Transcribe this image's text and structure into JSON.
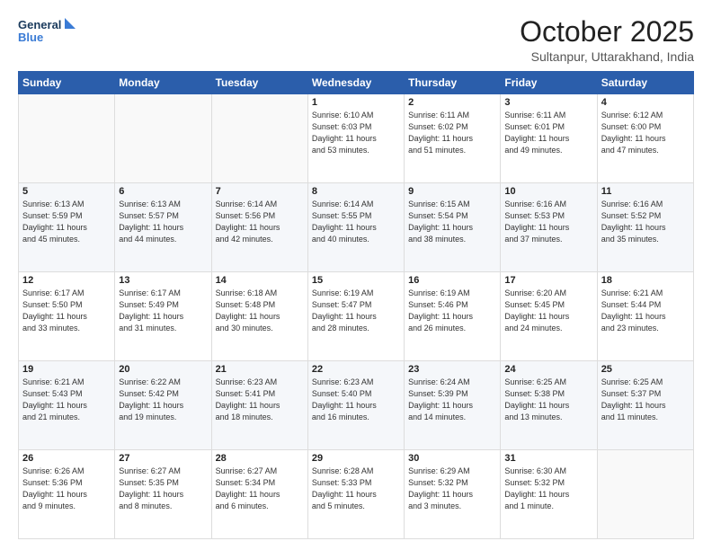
{
  "header": {
    "logo_line1": "General",
    "logo_line2": "Blue",
    "month": "October 2025",
    "location": "Sultanpur, Uttarakhand, India"
  },
  "days_of_week": [
    "Sunday",
    "Monday",
    "Tuesday",
    "Wednesday",
    "Thursday",
    "Friday",
    "Saturday"
  ],
  "weeks": [
    [
      {
        "day": "",
        "info": ""
      },
      {
        "day": "",
        "info": ""
      },
      {
        "day": "",
        "info": ""
      },
      {
        "day": "1",
        "info": "Sunrise: 6:10 AM\nSunset: 6:03 PM\nDaylight: 11 hours\nand 53 minutes."
      },
      {
        "day": "2",
        "info": "Sunrise: 6:11 AM\nSunset: 6:02 PM\nDaylight: 11 hours\nand 51 minutes."
      },
      {
        "day": "3",
        "info": "Sunrise: 6:11 AM\nSunset: 6:01 PM\nDaylight: 11 hours\nand 49 minutes."
      },
      {
        "day": "4",
        "info": "Sunrise: 6:12 AM\nSunset: 6:00 PM\nDaylight: 11 hours\nand 47 minutes."
      }
    ],
    [
      {
        "day": "5",
        "info": "Sunrise: 6:13 AM\nSunset: 5:59 PM\nDaylight: 11 hours\nand 45 minutes."
      },
      {
        "day": "6",
        "info": "Sunrise: 6:13 AM\nSunset: 5:57 PM\nDaylight: 11 hours\nand 44 minutes."
      },
      {
        "day": "7",
        "info": "Sunrise: 6:14 AM\nSunset: 5:56 PM\nDaylight: 11 hours\nand 42 minutes."
      },
      {
        "day": "8",
        "info": "Sunrise: 6:14 AM\nSunset: 5:55 PM\nDaylight: 11 hours\nand 40 minutes."
      },
      {
        "day": "9",
        "info": "Sunrise: 6:15 AM\nSunset: 5:54 PM\nDaylight: 11 hours\nand 38 minutes."
      },
      {
        "day": "10",
        "info": "Sunrise: 6:16 AM\nSunset: 5:53 PM\nDaylight: 11 hours\nand 37 minutes."
      },
      {
        "day": "11",
        "info": "Sunrise: 6:16 AM\nSunset: 5:52 PM\nDaylight: 11 hours\nand 35 minutes."
      }
    ],
    [
      {
        "day": "12",
        "info": "Sunrise: 6:17 AM\nSunset: 5:50 PM\nDaylight: 11 hours\nand 33 minutes."
      },
      {
        "day": "13",
        "info": "Sunrise: 6:17 AM\nSunset: 5:49 PM\nDaylight: 11 hours\nand 31 minutes."
      },
      {
        "day": "14",
        "info": "Sunrise: 6:18 AM\nSunset: 5:48 PM\nDaylight: 11 hours\nand 30 minutes."
      },
      {
        "day": "15",
        "info": "Sunrise: 6:19 AM\nSunset: 5:47 PM\nDaylight: 11 hours\nand 28 minutes."
      },
      {
        "day": "16",
        "info": "Sunrise: 6:19 AM\nSunset: 5:46 PM\nDaylight: 11 hours\nand 26 minutes."
      },
      {
        "day": "17",
        "info": "Sunrise: 6:20 AM\nSunset: 5:45 PM\nDaylight: 11 hours\nand 24 minutes."
      },
      {
        "day": "18",
        "info": "Sunrise: 6:21 AM\nSunset: 5:44 PM\nDaylight: 11 hours\nand 23 minutes."
      }
    ],
    [
      {
        "day": "19",
        "info": "Sunrise: 6:21 AM\nSunset: 5:43 PM\nDaylight: 11 hours\nand 21 minutes."
      },
      {
        "day": "20",
        "info": "Sunrise: 6:22 AM\nSunset: 5:42 PM\nDaylight: 11 hours\nand 19 minutes."
      },
      {
        "day": "21",
        "info": "Sunrise: 6:23 AM\nSunset: 5:41 PM\nDaylight: 11 hours\nand 18 minutes."
      },
      {
        "day": "22",
        "info": "Sunrise: 6:23 AM\nSunset: 5:40 PM\nDaylight: 11 hours\nand 16 minutes."
      },
      {
        "day": "23",
        "info": "Sunrise: 6:24 AM\nSunset: 5:39 PM\nDaylight: 11 hours\nand 14 minutes."
      },
      {
        "day": "24",
        "info": "Sunrise: 6:25 AM\nSunset: 5:38 PM\nDaylight: 11 hours\nand 13 minutes."
      },
      {
        "day": "25",
        "info": "Sunrise: 6:25 AM\nSunset: 5:37 PM\nDaylight: 11 hours\nand 11 minutes."
      }
    ],
    [
      {
        "day": "26",
        "info": "Sunrise: 6:26 AM\nSunset: 5:36 PM\nDaylight: 11 hours\nand 9 minutes."
      },
      {
        "day": "27",
        "info": "Sunrise: 6:27 AM\nSunset: 5:35 PM\nDaylight: 11 hours\nand 8 minutes."
      },
      {
        "day": "28",
        "info": "Sunrise: 6:27 AM\nSunset: 5:34 PM\nDaylight: 11 hours\nand 6 minutes."
      },
      {
        "day": "29",
        "info": "Sunrise: 6:28 AM\nSunset: 5:33 PM\nDaylight: 11 hours\nand 5 minutes."
      },
      {
        "day": "30",
        "info": "Sunrise: 6:29 AM\nSunset: 5:32 PM\nDaylight: 11 hours\nand 3 minutes."
      },
      {
        "day": "31",
        "info": "Sunrise: 6:30 AM\nSunset: 5:32 PM\nDaylight: 11 hours\nand 1 minute."
      },
      {
        "day": "",
        "info": ""
      }
    ]
  ]
}
